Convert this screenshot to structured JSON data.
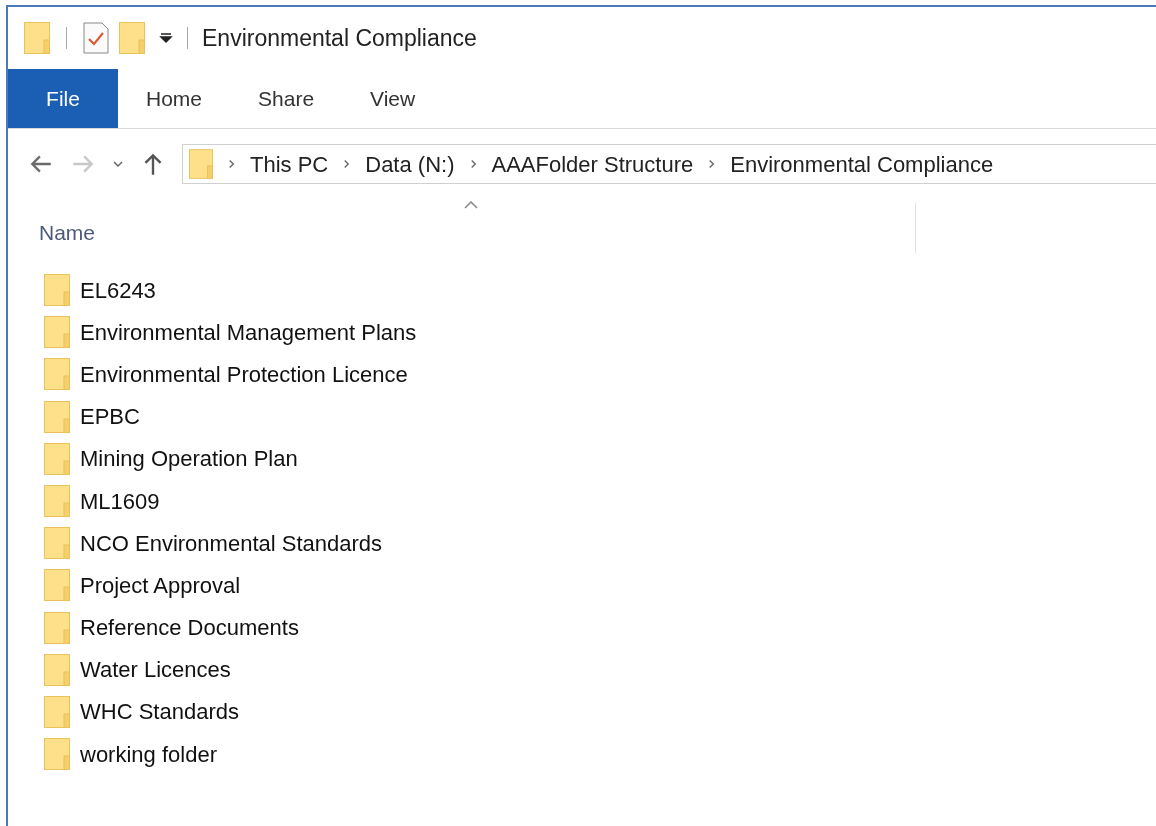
{
  "window": {
    "title": "Environmental Compliance"
  },
  "tabs": [
    {
      "label": "File",
      "selected": true
    },
    {
      "label": "Home",
      "selected": false
    },
    {
      "label": "Share",
      "selected": false
    },
    {
      "label": "View",
      "selected": false
    }
  ],
  "navigation": {
    "back": {
      "disabled": false
    },
    "forward": {
      "disabled": true
    }
  },
  "breadcrumb": [
    "This PC",
    "Data (N:)",
    "AAAFolder Structure",
    "Environmental Compliance"
  ],
  "columns": [
    "Name"
  ],
  "folders": [
    "EL6243",
    "Environmental Management Plans",
    "Environmental Protection Licence",
    "EPBC",
    "Mining Operation Plan",
    "ML1609",
    "NCO Environmental Standards",
    "Project Approval",
    "Reference Documents",
    "Water Licences",
    "WHC Standards",
    "working folder"
  ]
}
